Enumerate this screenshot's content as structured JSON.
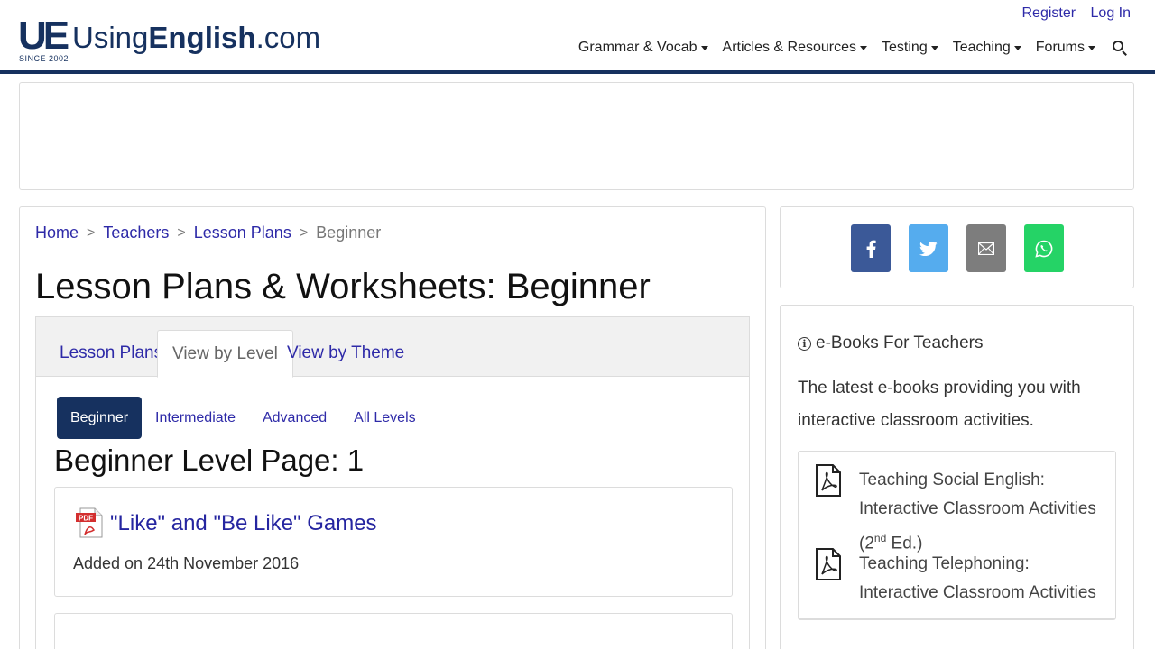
{
  "logo": {
    "mark": "UE",
    "since": "SINCE 2002",
    "name_prefix": "Using",
    "name_bold": "English",
    "name_suffix": ".com"
  },
  "top_links": {
    "register": "Register",
    "login": "Log In"
  },
  "nav": [
    {
      "label": "Grammar & Vocab"
    },
    {
      "label": "Articles & Resources"
    },
    {
      "label": "Testing"
    },
    {
      "label": "Teaching"
    },
    {
      "label": "Forums"
    }
  ],
  "breadcrumb": {
    "home": "Home",
    "teachers": "Teachers",
    "lesson_plans": "Lesson Plans",
    "current": "Beginner",
    "separator": ">"
  },
  "page_title": "Lesson Plans & Worksheets: Beginner",
  "tabs": [
    {
      "label": "Lesson Plans"
    },
    {
      "label": "View by Level"
    },
    {
      "label": "View by Theme"
    }
  ],
  "levels": [
    {
      "label": "Beginner"
    },
    {
      "label": "Intermediate"
    },
    {
      "label": "Advanced"
    },
    {
      "label": "All Levels"
    }
  ],
  "level_heading": "Beginner Level Page: 1",
  "items": [
    {
      "title": "\"Like\" and \"Be Like\" Games",
      "date": "Added on 24th November 2016"
    }
  ],
  "ebooks": {
    "heading": "e-Books For Teachers",
    "description": "The latest e-books providing you with interactive classroom activities.",
    "books": [
      {
        "title_before": "Teaching Social English: Interactive Classroom Activities (2",
        "sup": "nd",
        "title_after": " Ed.)"
      },
      {
        "title": "Teaching Telephoning: Interactive Classroom Activities"
      }
    ]
  },
  "colors": {
    "brand": "#16315f",
    "link": "#2e2aa8",
    "facebook": "#3b5998",
    "twitter": "#55acee",
    "email": "#7d7d7d",
    "whatsapp": "#25d366"
  },
  "icons": {
    "search": "search-icon",
    "facebook": "facebook-icon",
    "twitter": "twitter-icon",
    "email": "email-icon",
    "whatsapp": "whatsapp-icon",
    "pdf": "pdf-icon",
    "info": "info-icon"
  }
}
